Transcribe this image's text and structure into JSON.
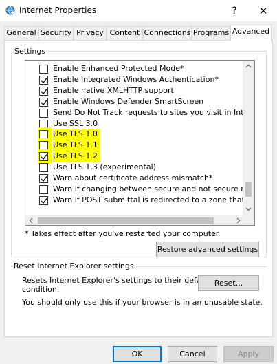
{
  "window": {
    "title": "Internet Properties",
    "help_glyph": "?",
    "close_glyph": "✕"
  },
  "tabs": [
    {
      "label": "General"
    },
    {
      "label": "Security"
    },
    {
      "label": "Privacy"
    },
    {
      "label": "Content"
    },
    {
      "label": "Connections"
    },
    {
      "label": "Programs"
    },
    {
      "label": "Advanced"
    }
  ],
  "settings": {
    "group_label": "Settings",
    "items": [
      {
        "label": "Enable Enhanced Protected Mode*",
        "checked": false,
        "highlighted": false
      },
      {
        "label": "Enable Integrated Windows Authentication*",
        "checked": true,
        "highlighted": false
      },
      {
        "label": "Enable native XMLHTTP support",
        "checked": true,
        "highlighted": false
      },
      {
        "label": "Enable Windows Defender SmartScreen",
        "checked": true,
        "highlighted": false
      },
      {
        "label": "Send Do Not Track requests to sites you visit in Internet E",
        "checked": false,
        "highlighted": false
      },
      {
        "label": "Use SSL 3.0",
        "checked": false,
        "highlighted": false
      },
      {
        "label": "Use TLS 1.0",
        "checked": false,
        "highlighted": true
      },
      {
        "label": "Use TLS 1.1",
        "checked": false,
        "highlighted": true
      },
      {
        "label": "Use TLS 1.2",
        "checked": true,
        "highlighted": true
      },
      {
        "label": "Use TLS 1.3 (experimental)",
        "checked": false,
        "highlighted": false
      },
      {
        "label": "Warn about certificate address mismatch*",
        "checked": true,
        "highlighted": false
      },
      {
        "label": "Warn if changing between secure and not secure mode",
        "checked": false,
        "highlighted": false
      },
      {
        "label": "Warn if POST submittal is redirected to a zone that does n",
        "checked": true,
        "highlighted": false
      }
    ],
    "note": "* Takes effect after you've restarted your computer",
    "restore_button": "Restore advanced settings"
  },
  "reset": {
    "group_label": "Reset Internet Explorer settings",
    "description_line1": "Resets Internet Explorer's settings to their default",
    "description_line2": "condition.",
    "reset_button": "Reset...",
    "warning": "You should only use this if your browser is in an unusable state."
  },
  "footer": {
    "ok": "OK",
    "cancel": "Cancel",
    "apply": "Apply"
  },
  "colors": {
    "highlight": "#ffff00",
    "accent": "#0078d7"
  }
}
